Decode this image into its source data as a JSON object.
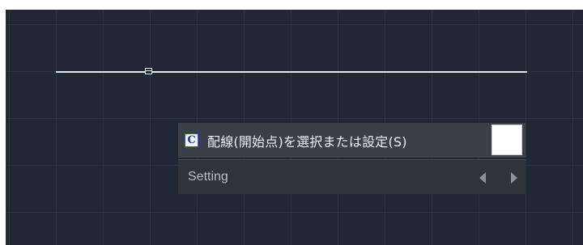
{
  "command_prompt": {
    "badge": "C",
    "text": "配線(開始点)を選択または設定(S)"
  },
  "setting_bar": {
    "label": "Setting",
    "prev_icon": "triangle-left-icon",
    "next_icon": "triangle-right-icon"
  },
  "colors": {
    "canvas_background": "#212835",
    "grid_line": "#2b3344",
    "wire": "#e8e8e8",
    "prompt_background": "#3a3f49",
    "setting_background": "#2f333b"
  }
}
